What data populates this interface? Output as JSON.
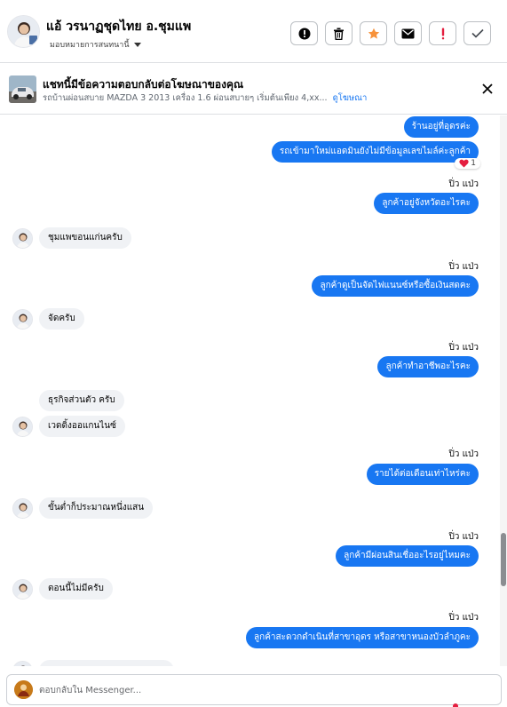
{
  "header": {
    "name": "แอ้ วรนาฏชุดไทย อ.ชุมแพ",
    "assign_label": "มอบหมายการสนทนานี้",
    "actions": [
      {
        "icon": "alert-circle-icon",
        "color": "#050505"
      },
      {
        "icon": "trash-icon",
        "color": "#050505"
      },
      {
        "icon": "star-icon",
        "color": "#f7923a"
      },
      {
        "icon": "envelope-icon",
        "color": "#050505"
      },
      {
        "icon": "exclamation-icon",
        "color": "#e41e3f"
      },
      {
        "icon": "check-icon",
        "color": "#444950"
      }
    ]
  },
  "ad": {
    "title": "แชทนี้มีข้อความตอบกลับต่อโฆษณาของคุณ",
    "subtitle": "รถบ้านผ่อนสบาย MAZDA 3 2013 เครื่อง 1.6 ผ่อนสบายๆ เริ่มต้นเพียง 4,xx...",
    "link": "ดูโฆษณา"
  },
  "messages": [
    {
      "dir": "out",
      "text": "ร้านอยู่ที่อุดรค่ะ"
    },
    {
      "dir": "out",
      "text": "รถเข้ามาใหม่แอดมินยังไม่มีข้อมูลเลขไมล์ค่ะลูกค้า",
      "reaction": {
        "emoji": "heart",
        "count": "1"
      }
    },
    {
      "dir": "sender",
      "text": "ปิ่ว แป่ว"
    },
    {
      "dir": "out",
      "text": "ลูกค้าอยู่จังหวัดอะไรคะ"
    },
    {
      "dir": "in",
      "text": "ชุมแพขอนแก่นครับ"
    },
    {
      "dir": "sender",
      "text": "ปิ่ว แป่ว"
    },
    {
      "dir": "out",
      "text": "ลูกค้าดูเป็นจัดไฟแนนซ์หรือซื้อเงินสดคะ"
    },
    {
      "dir": "in",
      "text": "จัดครับ"
    },
    {
      "dir": "sender",
      "text": "ปิ่ว แป่ว"
    },
    {
      "dir": "out",
      "text": "ลูกค้าทำอาชีพอะไรคะ"
    },
    {
      "dir": "in",
      "text": "ธุรกิจส่วนตัว ครับ"
    },
    {
      "dir": "in",
      "text": "เวดดิ้งออแกนไนซ์"
    },
    {
      "dir": "sender",
      "text": "ปิ่ว แป่ว"
    },
    {
      "dir": "out",
      "text": "รายได้ต่อเดือนเท่าไหร่คะ"
    },
    {
      "dir": "in",
      "text": "ขั้นต่ำก็ประมาณหนึ่งแสน"
    },
    {
      "dir": "sender",
      "text": "ปิ่ว แป่ว"
    },
    {
      "dir": "out",
      "text": "ลูกค้ามีผ่อนสินเชื่ออะไรอยู่ไหมคะ"
    },
    {
      "dir": "in",
      "text": "ตอนนี้ไม่มีครับ"
    },
    {
      "dir": "sender",
      "text": "ปิ่ว แป่ว"
    },
    {
      "dir": "out",
      "text": "ลูกค้าสะดวกดำเนินที่สาขาอุดร หรือสาขาหนองบัวลำภูคะ"
    }
  ],
  "composer": {
    "placeholder": "ตอบกลับใน Messenger..."
  },
  "colors": {
    "outgoing_bubble": "#1877f2",
    "incoming_bubble": "#f0f2f5",
    "link": "#1877f2"
  }
}
